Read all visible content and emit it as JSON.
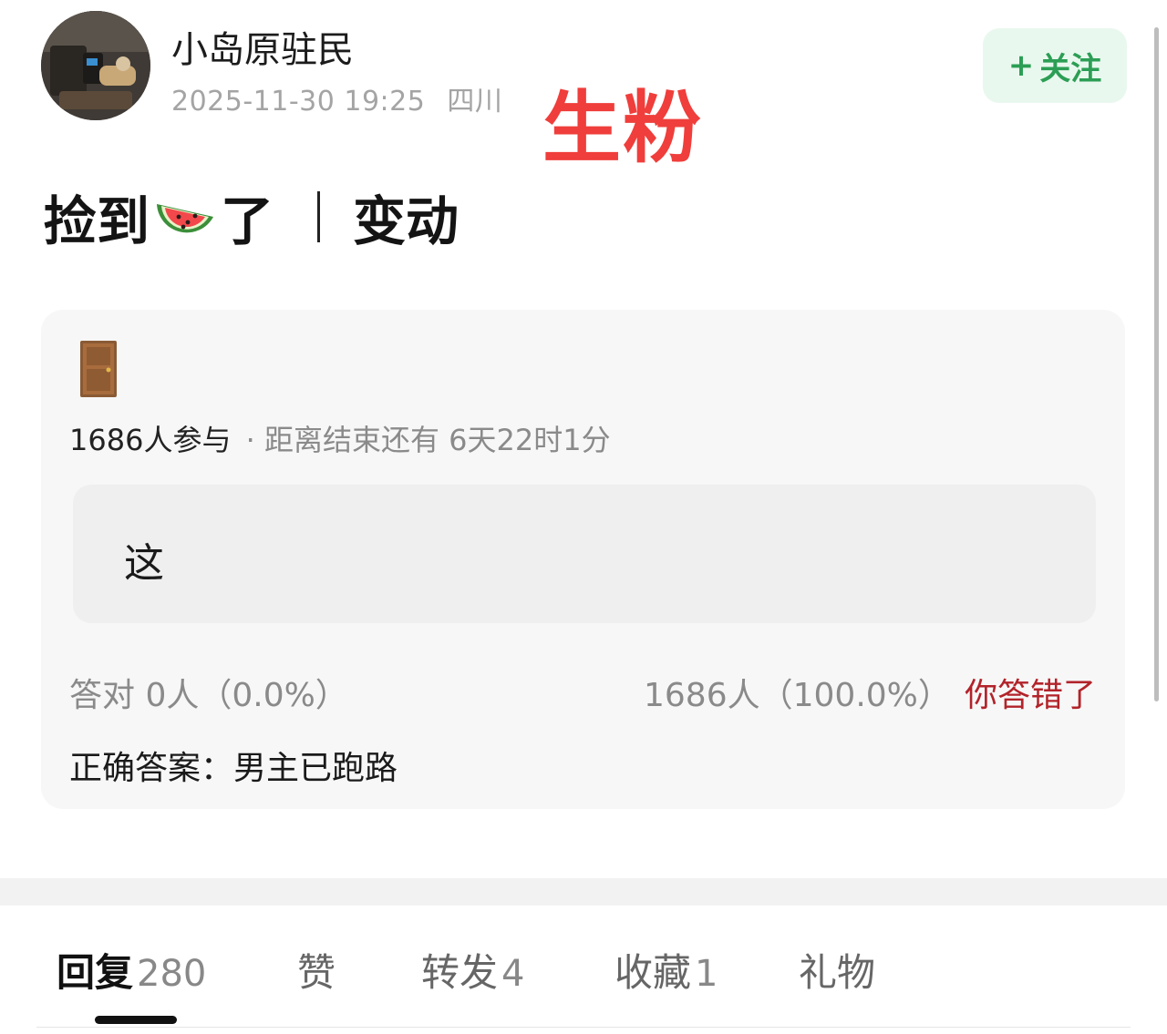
{
  "author": {
    "name": "小岛原驻民",
    "timestamp": "2025-11-30 19:25",
    "location": "四川"
  },
  "overlay_label": "生粉",
  "follow_button": {
    "icon": "+",
    "label": "关注"
  },
  "post": {
    "title_before": "捡到",
    "title_emoji": "🍉",
    "title_after": "了",
    "title_tag": "变动"
  },
  "quiz": {
    "icon": "door-icon",
    "participants": "1686人参与",
    "countdown": "· 距离结束还有 6天22时1分",
    "option_text": "这",
    "correct_stat": "答对  0人（0.0%）",
    "wrong_stat": "1686人（100.0%）",
    "wrong_badge": "你答错了",
    "answer_label": "正确答案：",
    "answer_value": "男主已跑路"
  },
  "tabs": [
    {
      "label": "回复",
      "count": "280",
      "active": true
    },
    {
      "label": "赞",
      "count": ""
    },
    {
      "label": "转发",
      "count": "4"
    },
    {
      "label": "收藏",
      "count": "1"
    },
    {
      "label": "礼物",
      "count": ""
    }
  ],
  "colors": {
    "accent_green": "#2c9e55",
    "follow_bg": "#e9f8ee",
    "overlay_red": "#ef3e3b",
    "wrong_red": "#b2232a"
  }
}
